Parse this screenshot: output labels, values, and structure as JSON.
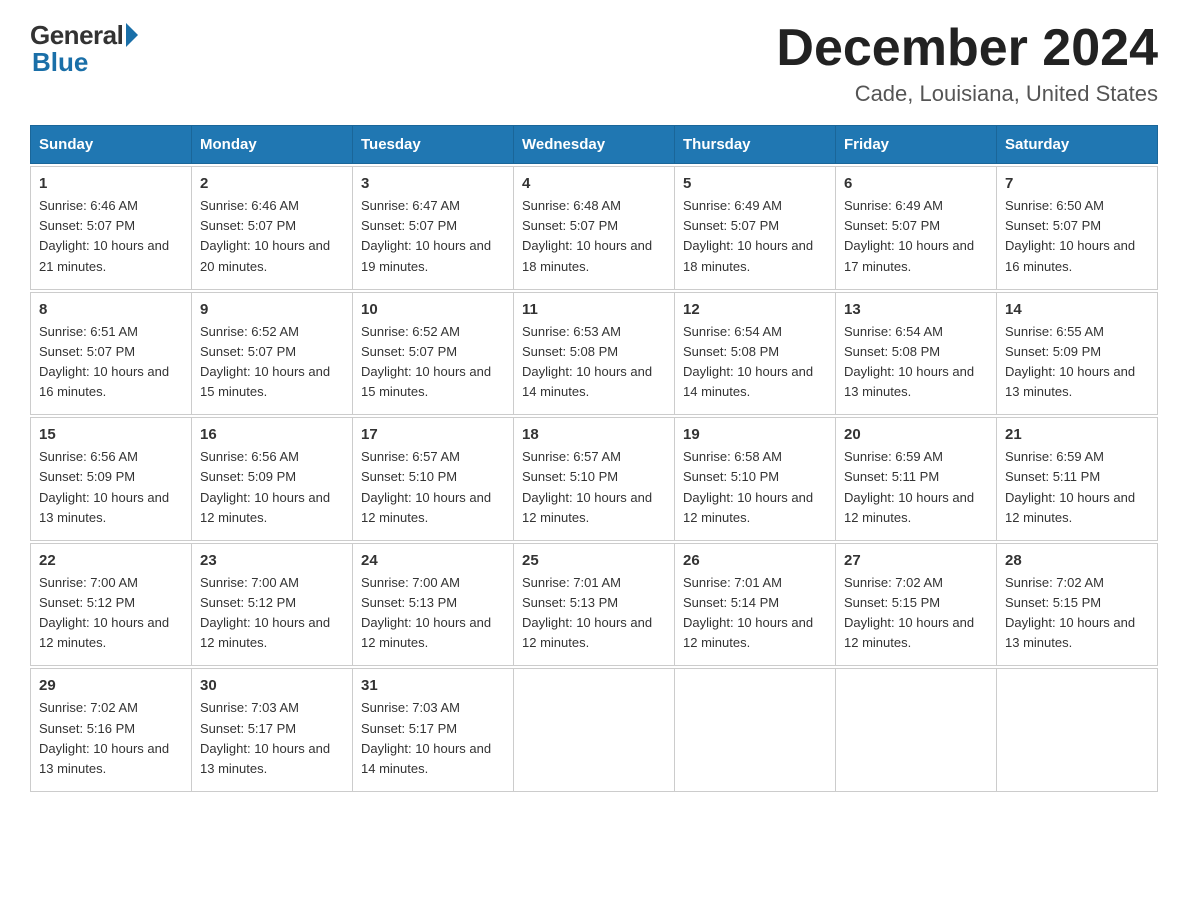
{
  "header": {
    "logo_general": "General",
    "logo_blue": "Blue",
    "month_title": "December 2024",
    "location": "Cade, Louisiana, United States"
  },
  "days_of_week": [
    "Sunday",
    "Monday",
    "Tuesday",
    "Wednesday",
    "Thursday",
    "Friday",
    "Saturday"
  ],
  "weeks": [
    [
      {
        "day": "1",
        "sunrise": "6:46 AM",
        "sunset": "5:07 PM",
        "daylight": "10 hours and 21 minutes."
      },
      {
        "day": "2",
        "sunrise": "6:46 AM",
        "sunset": "5:07 PM",
        "daylight": "10 hours and 20 minutes."
      },
      {
        "day": "3",
        "sunrise": "6:47 AM",
        "sunset": "5:07 PM",
        "daylight": "10 hours and 19 minutes."
      },
      {
        "day": "4",
        "sunrise": "6:48 AM",
        "sunset": "5:07 PM",
        "daylight": "10 hours and 18 minutes."
      },
      {
        "day": "5",
        "sunrise": "6:49 AM",
        "sunset": "5:07 PM",
        "daylight": "10 hours and 18 minutes."
      },
      {
        "day": "6",
        "sunrise": "6:49 AM",
        "sunset": "5:07 PM",
        "daylight": "10 hours and 17 minutes."
      },
      {
        "day": "7",
        "sunrise": "6:50 AM",
        "sunset": "5:07 PM",
        "daylight": "10 hours and 16 minutes."
      }
    ],
    [
      {
        "day": "8",
        "sunrise": "6:51 AM",
        "sunset": "5:07 PM",
        "daylight": "10 hours and 16 minutes."
      },
      {
        "day": "9",
        "sunrise": "6:52 AM",
        "sunset": "5:07 PM",
        "daylight": "10 hours and 15 minutes."
      },
      {
        "day": "10",
        "sunrise": "6:52 AM",
        "sunset": "5:07 PM",
        "daylight": "10 hours and 15 minutes."
      },
      {
        "day": "11",
        "sunrise": "6:53 AM",
        "sunset": "5:08 PM",
        "daylight": "10 hours and 14 minutes."
      },
      {
        "day": "12",
        "sunrise": "6:54 AM",
        "sunset": "5:08 PM",
        "daylight": "10 hours and 14 minutes."
      },
      {
        "day": "13",
        "sunrise": "6:54 AM",
        "sunset": "5:08 PM",
        "daylight": "10 hours and 13 minutes."
      },
      {
        "day": "14",
        "sunrise": "6:55 AM",
        "sunset": "5:09 PM",
        "daylight": "10 hours and 13 minutes."
      }
    ],
    [
      {
        "day": "15",
        "sunrise": "6:56 AM",
        "sunset": "5:09 PM",
        "daylight": "10 hours and 13 minutes."
      },
      {
        "day": "16",
        "sunrise": "6:56 AM",
        "sunset": "5:09 PM",
        "daylight": "10 hours and 12 minutes."
      },
      {
        "day": "17",
        "sunrise": "6:57 AM",
        "sunset": "5:10 PM",
        "daylight": "10 hours and 12 minutes."
      },
      {
        "day": "18",
        "sunrise": "6:57 AM",
        "sunset": "5:10 PM",
        "daylight": "10 hours and 12 minutes."
      },
      {
        "day": "19",
        "sunrise": "6:58 AM",
        "sunset": "5:10 PM",
        "daylight": "10 hours and 12 minutes."
      },
      {
        "day": "20",
        "sunrise": "6:59 AM",
        "sunset": "5:11 PM",
        "daylight": "10 hours and 12 minutes."
      },
      {
        "day": "21",
        "sunrise": "6:59 AM",
        "sunset": "5:11 PM",
        "daylight": "10 hours and 12 minutes."
      }
    ],
    [
      {
        "day": "22",
        "sunrise": "7:00 AM",
        "sunset": "5:12 PM",
        "daylight": "10 hours and 12 minutes."
      },
      {
        "day": "23",
        "sunrise": "7:00 AM",
        "sunset": "5:12 PM",
        "daylight": "10 hours and 12 minutes."
      },
      {
        "day": "24",
        "sunrise": "7:00 AM",
        "sunset": "5:13 PM",
        "daylight": "10 hours and 12 minutes."
      },
      {
        "day": "25",
        "sunrise": "7:01 AM",
        "sunset": "5:13 PM",
        "daylight": "10 hours and 12 minutes."
      },
      {
        "day": "26",
        "sunrise": "7:01 AM",
        "sunset": "5:14 PM",
        "daylight": "10 hours and 12 minutes."
      },
      {
        "day": "27",
        "sunrise": "7:02 AM",
        "sunset": "5:15 PM",
        "daylight": "10 hours and 12 minutes."
      },
      {
        "day": "28",
        "sunrise": "7:02 AM",
        "sunset": "5:15 PM",
        "daylight": "10 hours and 13 minutes."
      }
    ],
    [
      {
        "day": "29",
        "sunrise": "7:02 AM",
        "sunset": "5:16 PM",
        "daylight": "10 hours and 13 minutes."
      },
      {
        "day": "30",
        "sunrise": "7:03 AM",
        "sunset": "5:17 PM",
        "daylight": "10 hours and 13 minutes."
      },
      {
        "day": "31",
        "sunrise": "7:03 AM",
        "sunset": "5:17 PM",
        "daylight": "10 hours and 14 minutes."
      },
      null,
      null,
      null,
      null
    ]
  ],
  "labels": {
    "sunrise": "Sunrise:",
    "sunset": "Sunset:",
    "daylight": "Daylight:"
  },
  "colors": {
    "header_bg": "#2077b2",
    "divider": "#2077b2"
  }
}
